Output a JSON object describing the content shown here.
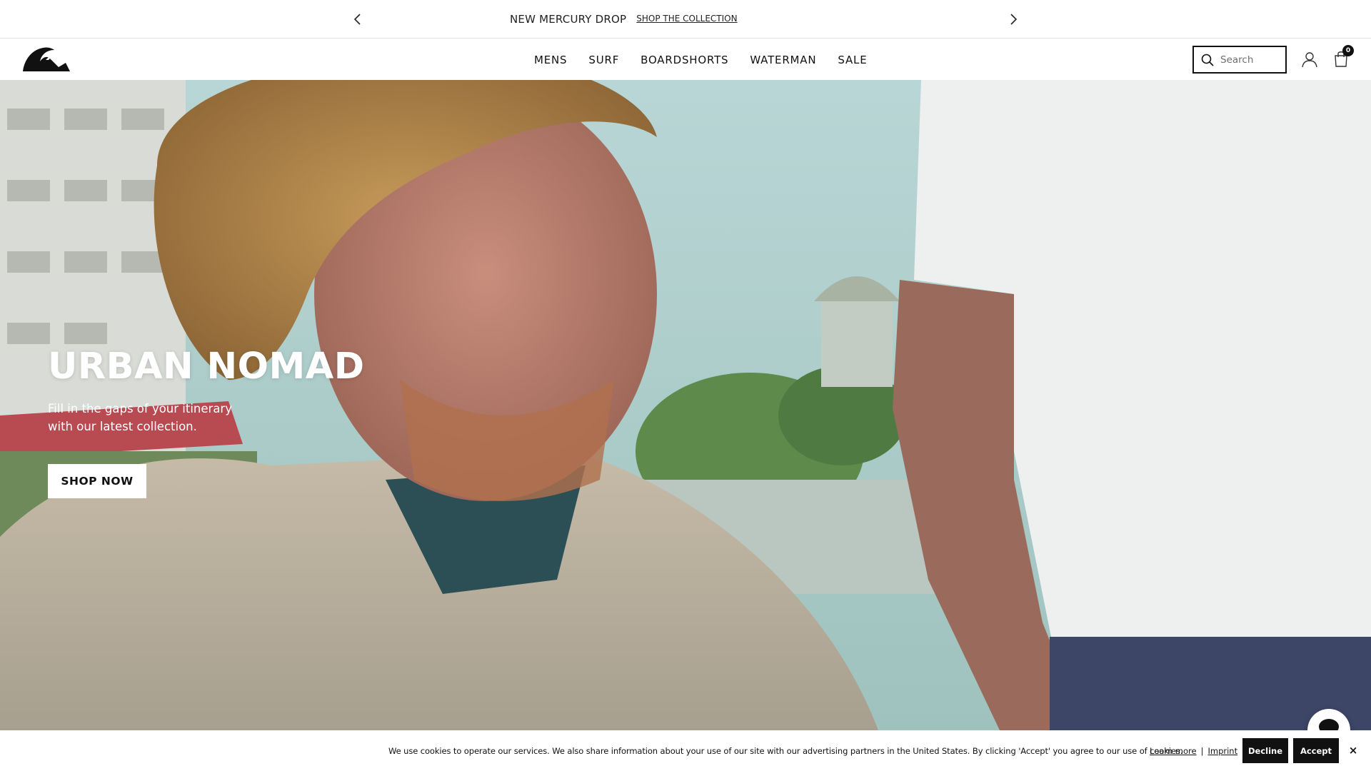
{
  "announcement": {
    "message": "NEW MERCURY DROP",
    "link": "SHOP THE COLLECTION",
    "prev_icon": "chevron-left-icon",
    "next_icon": "chevron-right-icon"
  },
  "header": {
    "logo": "quiksilver-logo",
    "nav": [
      "MENS",
      "SURF",
      "BOARDSHORTS",
      "WATERMAN",
      "SALE"
    ],
    "search_placeholder": "Search",
    "search_icon": "search-icon",
    "account_icon": "user-icon",
    "cart_icon": "bag-icon",
    "cart_count": "0"
  },
  "hero": {
    "title": "URBAN NOMAD",
    "subtitle": "Fill in the gaps of your itinerary with our latest collection.",
    "cta": "SHOP NOW"
  },
  "cookie": {
    "text": "We use cookies to operate our services. We also share information about your use of our site with our advertising partners in the United States. By clicking 'Accept' you agree to our use of cookies.",
    "learn_more": "Learn more",
    "separator": "|",
    "imprint": "Imprint",
    "decline": "Decline",
    "accept": "Accept",
    "close": "×"
  },
  "chat_icon": "chat-bubble-icon",
  "colors": {
    "text": "#111111",
    "button_dark": "#111111",
    "hero_bg": "#a9c7c4"
  }
}
